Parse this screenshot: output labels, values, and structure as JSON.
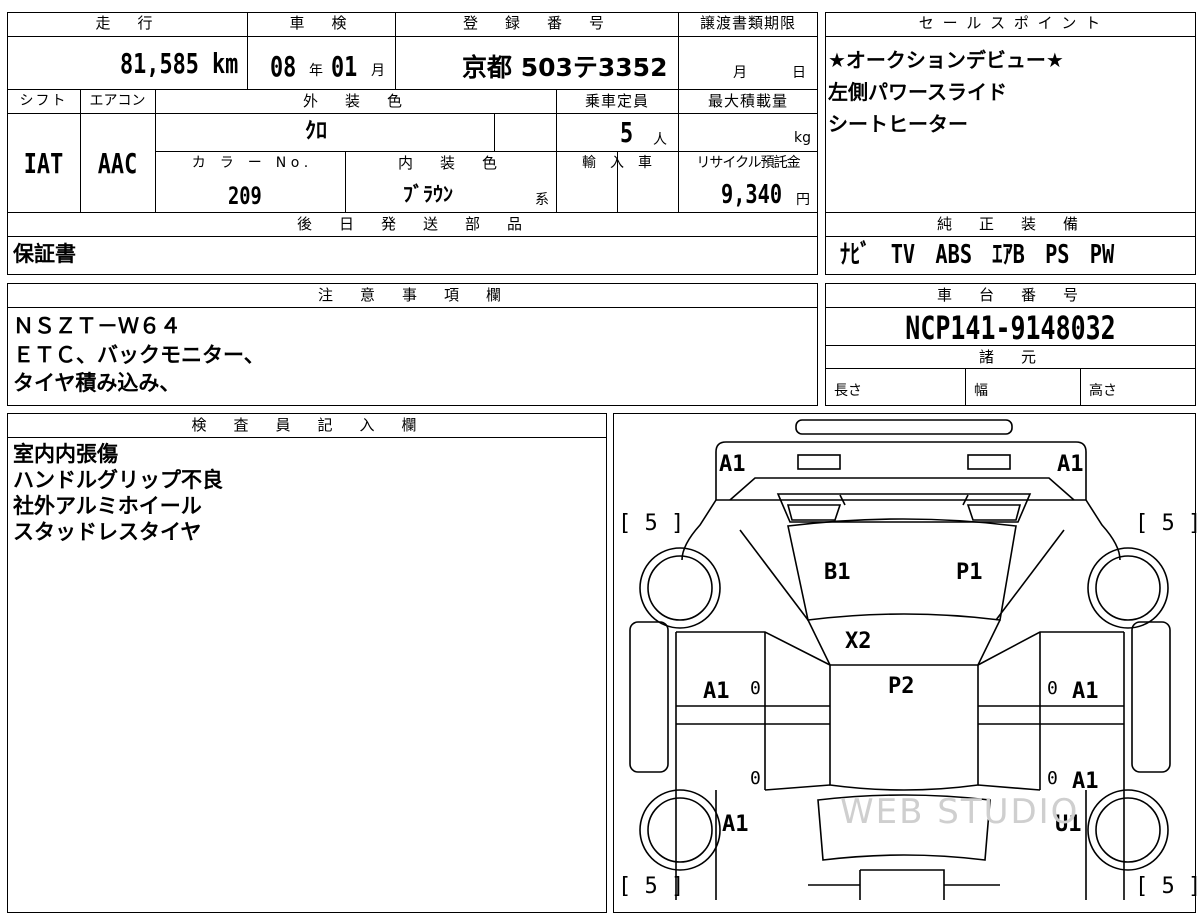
{
  "top_sheet": {
    "headers": {
      "mileage": "走　行",
      "inspection": "車　検",
      "registration": "登　録　番　号",
      "transfer_deadline": "譲渡書類期限",
      "shift": "シフト",
      "aircon": "エアコン",
      "exterior_color": "外　装　色",
      "capacity": "乗車定員",
      "max_load": "最大積載量",
      "color_no": "カ　ラ　ー　N o .",
      "interior_color": "内　装　色",
      "import": "輸　入　車",
      "recycle": "リサイクル預託金"
    },
    "values": {
      "mileage": "81,585",
      "mileage_unit": "km",
      "inspection_year": "08",
      "year_unit": "年",
      "inspection_month": "01",
      "month_unit": "月",
      "registration": "京都 503テ3352",
      "transfer_month_unit": "月",
      "transfer_day_unit": "日",
      "shift": "IAT",
      "aircon": "AAC",
      "exterior_color": "ｸﾛ",
      "capacity": "5",
      "capacity_unit": "人",
      "max_load_unit": "kg",
      "color_no": "209",
      "interior_color": "ﾌﾞﾗｳﾝ",
      "interior_suffix": "系",
      "recycle": "9,340",
      "recycle_unit": "円"
    },
    "later_parts_header": "後　日　発　送　部　品",
    "later_parts_value": "保証書"
  },
  "sales_points": {
    "header": "セ ー ル ス ポ イ ン ト",
    "lines": [
      "★オークションデビュー★",
      "左側パワースライド",
      "シートヒーター"
    ]
  },
  "standard_equipment": {
    "header": "純　正　装　備",
    "value": "ﾅﾋﾞ　TV　ABS　ｴｱB　PS　PW"
  },
  "notes": {
    "header": "注　意　事　項　欄",
    "lines": [
      "ＮＳＺＴ－Ｗ６４",
      "ＥＴＣ、バックモニター、",
      "タイヤ積み込み、"
    ]
  },
  "chassis": {
    "header": "車　台　番　号",
    "number": "NCP141-9148032",
    "specs_header": "諸　元",
    "length_label": "長さ",
    "width_label": "幅",
    "height_label": "高さ"
  },
  "inspector": {
    "header": "検　査　員　記　入　欄",
    "lines": [
      "室内内張傷",
      "ハンドルグリップ不良",
      "社外アルミホイール",
      "スタッドレスタイヤ"
    ]
  },
  "diagram": {
    "tire_marks": {
      "front_left": "[ 5 ]",
      "front_right": "[ 5 ]",
      "rear_left": "[ 5 ]",
      "rear_right": "[ 5 ]"
    },
    "labels": {
      "front_left": "A1",
      "front_right": "A1",
      "hood_left": "B1",
      "hood_right": "P1",
      "windshield": "X2",
      "roof": "P2",
      "left_front_door": "A1",
      "right_front_door": "A1",
      "right_rear_door": "A1",
      "left_rear_fender": "A1",
      "right_rear_fender": "U1"
    },
    "zeros": [
      "0",
      "0",
      "0",
      "0"
    ],
    "watermark": "WEB STUDIO"
  }
}
